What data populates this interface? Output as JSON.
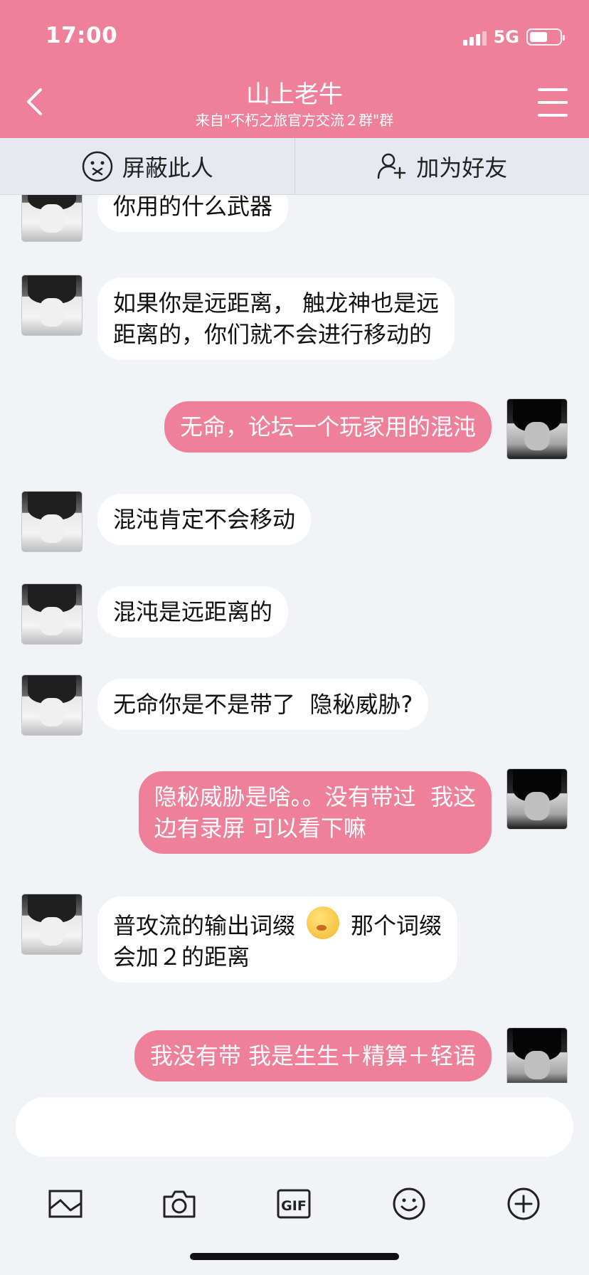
{
  "status_bar": {
    "time": "17:00",
    "network": "5G"
  },
  "header": {
    "title": "山上老牛",
    "subtitle": "来自\"不朽之旅官方交流２群\"群"
  },
  "actions": {
    "block_label": "屏蔽此人",
    "add_friend_label": "加为好友"
  },
  "messages": [
    {
      "sender": "them",
      "text": "你用的什么武器"
    },
    {
      "sender": "them",
      "text": "如果你是远距离， 触龙神也是远\n距离的，你们就不会进行移动的"
    },
    {
      "sender": "me",
      "text": "无命，论坛一个玩家用的混沌"
    },
    {
      "sender": "them",
      "text": "混沌肯定不会移动"
    },
    {
      "sender": "them",
      "text": "混沌是远距离的"
    },
    {
      "sender": "them",
      "text": "无命你是不是带了  隐秘威胁?"
    },
    {
      "sender": "me",
      "text": "隐秘威胁是啥。。没有带过  我这\n边有录屏 可以看下嘛"
    },
    {
      "sender": "them",
      "text_before": "普攻流的输出词缀",
      "emoji": "thinking-face-emoji",
      "text_after": "那个词缀",
      "text_line2": "会加２的距离"
    },
    {
      "sender": "me",
      "text": "我没有带 我是生生＋精算＋轻语"
    }
  ],
  "input": {
    "value": "",
    "placeholder": ""
  },
  "toolbar": {
    "icons": [
      "image-icon",
      "camera-icon",
      "gif-icon",
      "emoji-icon",
      "plus-icon"
    ]
  },
  "colors": {
    "accent": "#ee8099",
    "background": "#f2f3f7",
    "action_bar": "#e6e9f0"
  }
}
